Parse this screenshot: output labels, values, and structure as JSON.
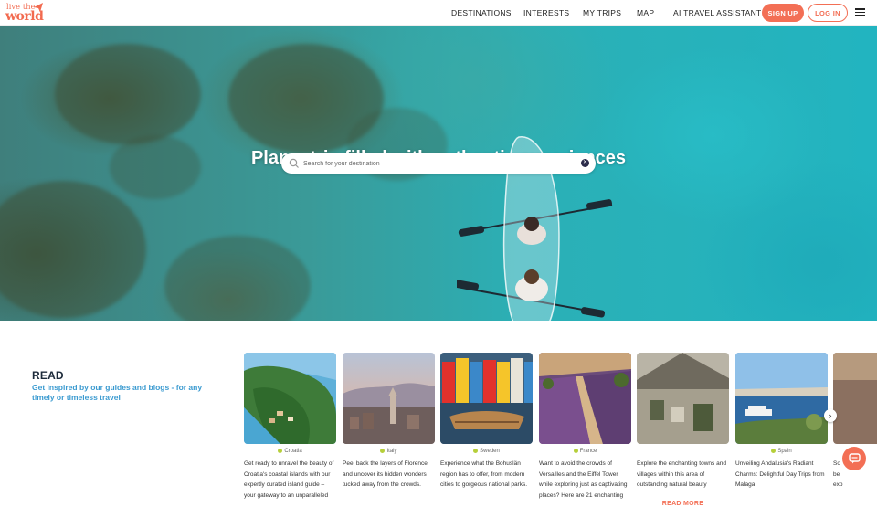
{
  "header": {
    "logo": {
      "line1": "live the",
      "line2": "world"
    },
    "nav": [
      "DESTINATIONS",
      "INTERESTS",
      "MY TRIPS",
      "MAP",
      "AI TRAVEL ASSISTANT"
    ],
    "signup_label": "SIGN UP",
    "login_label": "LOG IN",
    "menu_icon": "hamburger-icon"
  },
  "hero": {
    "title": "Plan a trip filled with authentic experiences",
    "search_placeholder": "Search for your destination",
    "search_icon": "search-icon",
    "clear_icon": "clear-icon"
  },
  "read": {
    "title": "READ",
    "subtitle": "Get inspired by our guides and blogs - for any timely or timeless travel"
  },
  "cards": [
    {
      "country": "Croatia",
      "desc": "Get ready to unravel the beauty of Croatia's coastal islands with our expertly curated island guide – your gateway to an unparalleled",
      "more": ""
    },
    {
      "country": "Italy",
      "desc": "Peel back the layers of Florence and uncover its hidden wonders tucked away from the crowds.",
      "more": "READ MORE"
    },
    {
      "country": "Sweden",
      "desc": "Experience what the Bohuslän region has to offer, from modern cities to gorgeous national parks.",
      "more": "READ MORE"
    },
    {
      "country": "France",
      "desc": "Want to avoid the crowds of Versailles and the Eiffel Tower while exploring just as captivating places? Here are 21 enchanting",
      "more": ""
    },
    {
      "country": "",
      "desc": "Explore the enchanting towns and villages within this area of outstanding natural beauty",
      "more": "READ MORE"
    },
    {
      "country": "Spain",
      "desc": "Unveiling Andalusia's Radiant Charms: Delightful Day Trips from Malaga",
      "more": ""
    },
    {
      "country": "",
      "desc": "So be exp",
      "more": ""
    }
  ],
  "colors": {
    "accent": "#f36f55",
    "subtitle_blue": "#3a9ad0",
    "tag_pin": "#b6cf3a"
  }
}
